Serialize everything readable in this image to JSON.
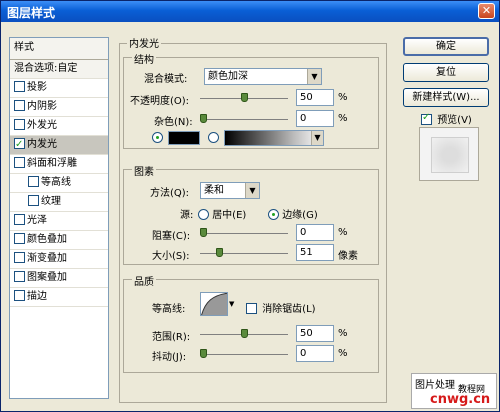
{
  "window": {
    "title": "图层样式",
    "close": "✕"
  },
  "stylelist": {
    "header": "样式",
    "blend": "混合选项:自定",
    "items": [
      {
        "label": "投影",
        "checked": false,
        "sub": false
      },
      {
        "label": "内阴影",
        "checked": false,
        "sub": false
      },
      {
        "label": "外发光",
        "checked": false,
        "sub": false
      },
      {
        "label": "内发光",
        "checked": true,
        "sub": false
      },
      {
        "label": "斜面和浮雕",
        "checked": false,
        "sub": false
      },
      {
        "label": "等高线",
        "checked": false,
        "sub": true
      },
      {
        "label": "纹理",
        "checked": false,
        "sub": true
      },
      {
        "label": "光泽",
        "checked": false,
        "sub": false
      },
      {
        "label": "颜色叠加",
        "checked": false,
        "sub": false
      },
      {
        "label": "渐变叠加",
        "checked": false,
        "sub": false
      },
      {
        "label": "图案叠加",
        "checked": false,
        "sub": false
      },
      {
        "label": "描边",
        "checked": false,
        "sub": false
      }
    ]
  },
  "main": {
    "title": "内发光",
    "structure": {
      "title": "结构",
      "blend_mode_label": "混合模式:",
      "blend_mode_value": "颜色加深",
      "opacity_label": "不透明度(O):",
      "opacity_value": "50",
      "noise_label": "杂色(N):",
      "noise_value": "0",
      "percent": "%"
    },
    "elements": {
      "title": "图素",
      "method_label": "方法(Q):",
      "method_value": "柔和",
      "source_label": "源:",
      "center_label": "居中(E)",
      "edge_label": "边缘(G)",
      "choke_label": "阻塞(C):",
      "choke_value": "0",
      "size_label": "大小(S):",
      "size_value": "51",
      "percent": "%",
      "px": "像素"
    },
    "quality": {
      "title": "品质",
      "contour_label": "等高线:",
      "antialias_label": "消除锯齿(L)",
      "range_label": "范围(R):",
      "range_value": "50",
      "jitter_label": "抖动(J):",
      "jitter_value": "0",
      "percent": "%"
    }
  },
  "buttons": {
    "ok": "确定",
    "reset": "复位",
    "new_style": "新建样式(W)...",
    "preview": "预览(V)"
  },
  "sliders": {
    "opacity": 0.5,
    "noise": 0.0,
    "choke": 0.0,
    "size": 0.2,
    "range": 0.5,
    "jitter": 0.0
  },
  "watermark": {
    "line1": "图片处理",
    "line2": "教程网",
    "line3": "cnwg.cn"
  },
  "colors": {
    "accent": "#0a5fd6",
    "checked": "#21a121",
    "glow": "#000000"
  }
}
